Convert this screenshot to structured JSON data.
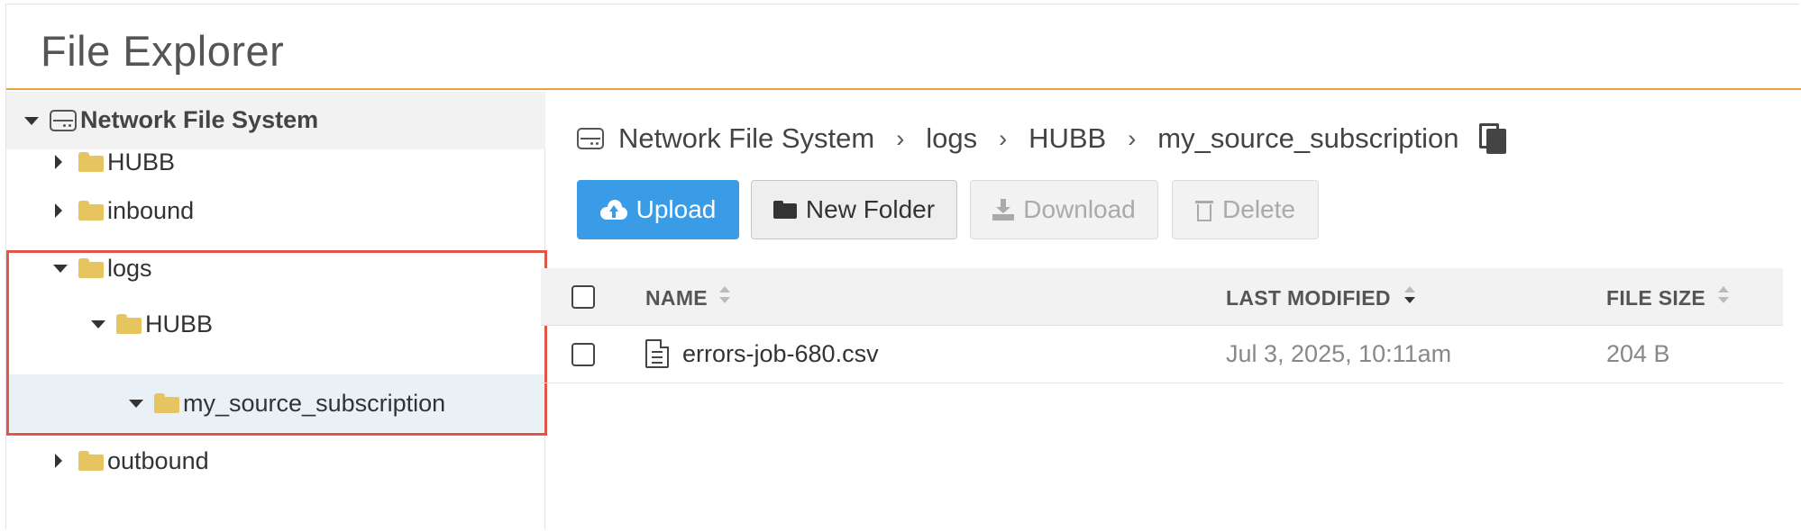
{
  "header": {
    "title": "File Explorer"
  },
  "tree": {
    "root": {
      "label": "Network File System",
      "icon": "drive-icon"
    },
    "items": [
      {
        "label": "HUBB",
        "state": "collapsed"
      },
      {
        "label": "inbound",
        "state": "collapsed"
      },
      {
        "label": "logs",
        "state": "expanded"
      },
      {
        "label": "HUBB",
        "state": "expanded"
      },
      {
        "label": "my_source_subscription",
        "state": "expanded",
        "selected": true
      },
      {
        "label": "outbound",
        "state": "collapsed"
      }
    ]
  },
  "breadcrumb": [
    "Network File System",
    "logs",
    "HUBB",
    "my_source_subscription"
  ],
  "breadcrumb_separator": "›",
  "toolbar": {
    "upload": "Upload",
    "new_folder": "New Folder",
    "download": "Download",
    "delete": "Delete"
  },
  "table": {
    "columns": {
      "name": "NAME",
      "modified": "LAST MODIFIED",
      "size": "FILE SIZE"
    },
    "rows": [
      {
        "name": "errors-job-680.csv",
        "modified": "Jul 3, 2025, 10:11am",
        "size": "204 B"
      }
    ]
  },
  "colors": {
    "accent": "#e8a33d",
    "primary": "#3a9be6",
    "folder": "#e6c45f",
    "highlight": "#e0574a"
  }
}
